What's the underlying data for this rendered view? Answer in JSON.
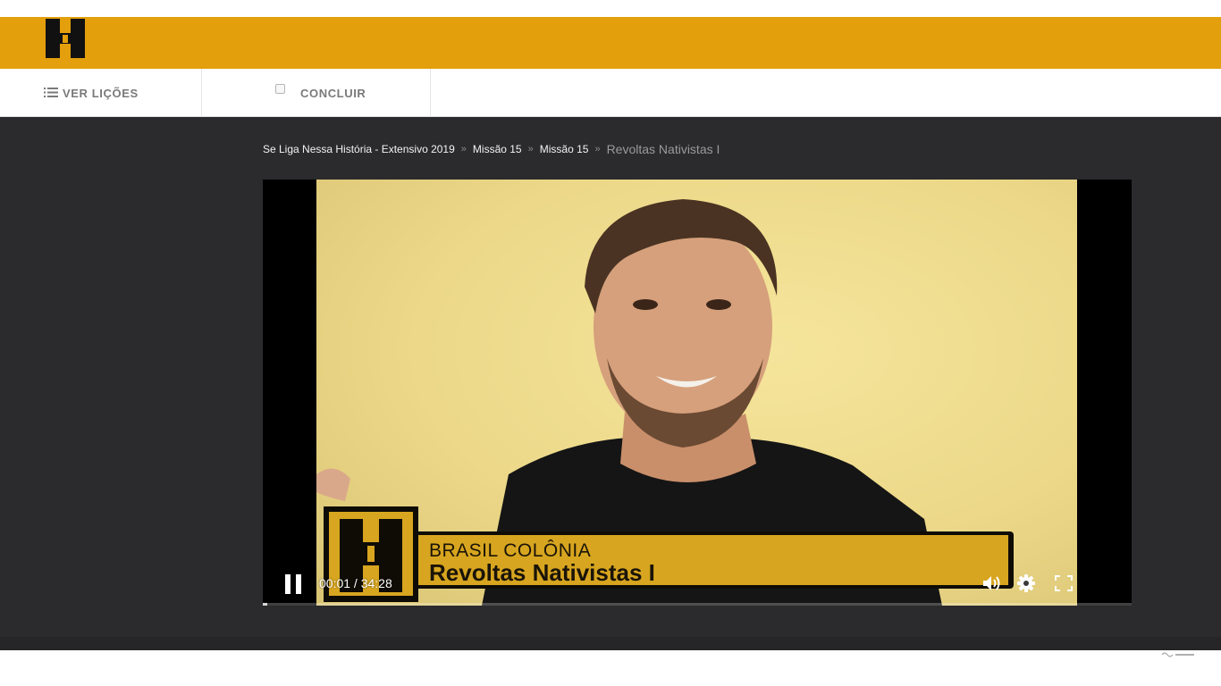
{
  "nav": {
    "lessons_label": "VER LIÇÕES",
    "finish_label": "CONCLUIR"
  },
  "breadcrumb": {
    "items": [
      "Se Liga Nessa História - Extensivo 2019",
      "Missão 15",
      "Missão 15"
    ],
    "current": "Revoltas Nativistas I"
  },
  "video": {
    "lower_third_line1": "BRASIL COLÔNIA",
    "lower_third_line2": "Revoltas Nativistas I",
    "current_time": "00:01",
    "duration": "34:28",
    "time_separator": " / ",
    "progress_fraction": 0.0005
  },
  "icons": {
    "logo": "letter-h-logo",
    "lessons": "list-icon",
    "finish": "checkbox-icon",
    "pause": "pause-icon",
    "volume": "volume-icon",
    "settings": "gear-icon",
    "fullscreen": "fullscreen-icon"
  },
  "colors": {
    "header": "#e39f0c",
    "page_bg": "#2b2b2d",
    "lower_third_gold": "#d7a51f"
  }
}
